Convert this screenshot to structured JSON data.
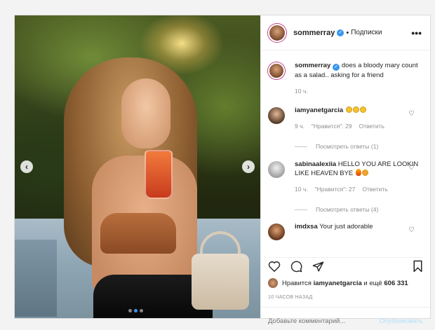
{
  "post": {
    "username": "sommerray",
    "separator": "•",
    "follow_label": "Подписки",
    "more_label": "•••"
  },
  "comments": [
    {
      "username": "sommerray",
      "text": "does a bloody mary count as a salad.. asking for a friend",
      "time": "10 ч."
    },
    {
      "username": "iamyanetgarcia",
      "text": "",
      "emoji": [
        "grinning-face",
        "grinning-face",
        "grinning-face"
      ],
      "time": "9 ч.",
      "likes": "\"Нравится\": 29",
      "reply_label": "Ответить",
      "view_replies": "Посмотреть ответы (1)"
    },
    {
      "username": "sabinaalexiia",
      "text": "HELLO YOU ARE LOOKIN LIKE HEAVEN BYE",
      "emoji": [
        "fire",
        "heart-eyes"
      ],
      "time": "10 ч.",
      "likes": "\"Нравится\": 27",
      "reply_label": "Ответить",
      "view_replies": "Посмотреть ответы (4)"
    },
    {
      "username": "imdxsa",
      "text": "Your just adorable"
    }
  ],
  "likes": {
    "prefix": "Нравится",
    "user": "iamyanetgarcia",
    "conj": "и ещё",
    "count": "606 331"
  },
  "timestamp": "10 ЧАСОВ НАЗАД",
  "comment_input": {
    "placeholder": "Добавьте комментарий...",
    "publish_label": "Опубликовать"
  },
  "carousel": {
    "prev_label": "‹",
    "next_label": "›",
    "current_index": 1,
    "total": 3
  },
  "colors": {
    "accent": "#3897f0",
    "publish_disabled": "#b2dffc",
    "muted": "#8e8e8e"
  }
}
